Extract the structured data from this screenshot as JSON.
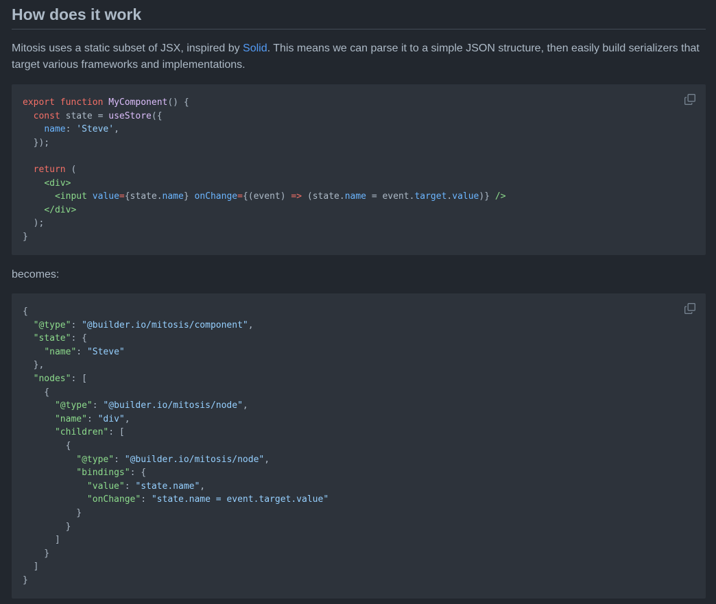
{
  "section": {
    "title": "How does it work",
    "intro_before": "Mitosis uses a static subset of JSX, inspired by ",
    "intro_link": "Solid",
    "intro_after": ". This means we can parse it to a simple JSON structure, then easily build serializers that target various frameworks and implementations.",
    "becomes_label": "becomes:"
  },
  "code_blocks": [
    {
      "copy_icon": "copy-icon",
      "lines": [
        [
          [
            "kw",
            "export "
          ],
          [
            "kw",
            "function "
          ],
          [
            "fn",
            "MyComponent"
          ],
          [
            "pl",
            "() {"
          ]
        ],
        [
          [
            "pl",
            "  "
          ],
          [
            "kw",
            "const "
          ],
          [
            "pl",
            "state = "
          ],
          [
            "fn",
            "useStore"
          ],
          [
            "pl",
            "({"
          ]
        ],
        [
          [
            "pl",
            "    "
          ],
          [
            "prop",
            "name"
          ],
          [
            "pl",
            ": "
          ],
          [
            "str",
            "'Steve'"
          ],
          [
            "pl",
            ","
          ]
        ],
        [
          [
            "pl",
            "  });"
          ]
        ],
        [
          [
            "pl",
            ""
          ]
        ],
        [
          [
            "pl",
            "  "
          ],
          [
            "kw",
            "return "
          ],
          [
            "pl",
            "("
          ]
        ],
        [
          [
            "pl",
            "    "
          ],
          [
            "tag",
            "<div"
          ],
          [
            "tag",
            ">"
          ]
        ],
        [
          [
            "pl",
            "      "
          ],
          [
            "tag",
            "<input "
          ],
          [
            "prop",
            "value"
          ],
          [
            "kw",
            "="
          ],
          [
            "pl",
            "{state."
          ],
          [
            "prop",
            "name"
          ],
          [
            "pl",
            "} "
          ],
          [
            "prop",
            "onChange"
          ],
          [
            "kw",
            "="
          ],
          [
            "pl",
            "{(event) "
          ],
          [
            "kw",
            "=>"
          ],
          [
            "pl",
            " (state."
          ],
          [
            "prop",
            "name"
          ],
          [
            "pl",
            " = event."
          ],
          [
            "prop",
            "target"
          ],
          [
            "pl",
            "."
          ],
          [
            "prop",
            "value"
          ],
          [
            "pl",
            ")} "
          ],
          [
            "tag",
            "/>"
          ]
        ],
        [
          [
            "pl",
            "    "
          ],
          [
            "tag",
            "</div>"
          ]
        ],
        [
          [
            "pl",
            "  );"
          ]
        ],
        [
          [
            "pl",
            "}"
          ]
        ]
      ]
    },
    {
      "copy_icon": "copy-icon",
      "lines": [
        [
          [
            "pl",
            "{"
          ]
        ],
        [
          [
            "pl",
            "  "
          ],
          [
            "key",
            "\"@type\""
          ],
          [
            "pl",
            ": "
          ],
          [
            "str",
            "\"@builder.io/mitosis/component\""
          ],
          [
            "pl",
            ","
          ]
        ],
        [
          [
            "pl",
            "  "
          ],
          [
            "key",
            "\"state\""
          ],
          [
            "pl",
            ": {"
          ]
        ],
        [
          [
            "pl",
            "    "
          ],
          [
            "key",
            "\"name\""
          ],
          [
            "pl",
            ": "
          ],
          [
            "str",
            "\"Steve\""
          ]
        ],
        [
          [
            "pl",
            "  },"
          ]
        ],
        [
          [
            "pl",
            "  "
          ],
          [
            "key",
            "\"nodes\""
          ],
          [
            "pl",
            ": ["
          ]
        ],
        [
          [
            "pl",
            "    {"
          ]
        ],
        [
          [
            "pl",
            "      "
          ],
          [
            "key",
            "\"@type\""
          ],
          [
            "pl",
            ": "
          ],
          [
            "str",
            "\"@builder.io/mitosis/node\""
          ],
          [
            "pl",
            ","
          ]
        ],
        [
          [
            "pl",
            "      "
          ],
          [
            "key",
            "\"name\""
          ],
          [
            "pl",
            ": "
          ],
          [
            "str",
            "\"div\""
          ],
          [
            "pl",
            ","
          ]
        ],
        [
          [
            "pl",
            "      "
          ],
          [
            "key",
            "\"children\""
          ],
          [
            "pl",
            ": ["
          ]
        ],
        [
          [
            "pl",
            "        {"
          ]
        ],
        [
          [
            "pl",
            "          "
          ],
          [
            "key",
            "\"@type\""
          ],
          [
            "pl",
            ": "
          ],
          [
            "str",
            "\"@builder.io/mitosis/node\""
          ],
          [
            "pl",
            ","
          ]
        ],
        [
          [
            "pl",
            "          "
          ],
          [
            "key",
            "\"bindings\""
          ],
          [
            "pl",
            ": {"
          ]
        ],
        [
          [
            "pl",
            "            "
          ],
          [
            "key",
            "\"value\""
          ],
          [
            "pl",
            ": "
          ],
          [
            "str",
            "\"state.name\""
          ],
          [
            "pl",
            ","
          ]
        ],
        [
          [
            "pl",
            "            "
          ],
          [
            "key",
            "\"onChange\""
          ],
          [
            "pl",
            ": "
          ],
          [
            "str",
            "\"state.name = event.target.value\""
          ]
        ],
        [
          [
            "pl",
            "          }"
          ]
        ],
        [
          [
            "pl",
            "        }"
          ]
        ],
        [
          [
            "pl",
            "      ]"
          ]
        ],
        [
          [
            "pl",
            "    }"
          ]
        ],
        [
          [
            "pl",
            "  ]"
          ]
        ],
        [
          [
            "pl",
            "}"
          ]
        ]
      ]
    }
  ],
  "colors": {
    "background": "#22272e",
    "code_background": "#2d333b",
    "text": "#adbac7",
    "link": "#539bf5",
    "keyword": "#f47067",
    "function": "#dcbdfb",
    "string": "#96d0ff",
    "property": "#6cb6ff",
    "tag": "#8ddb8c"
  }
}
